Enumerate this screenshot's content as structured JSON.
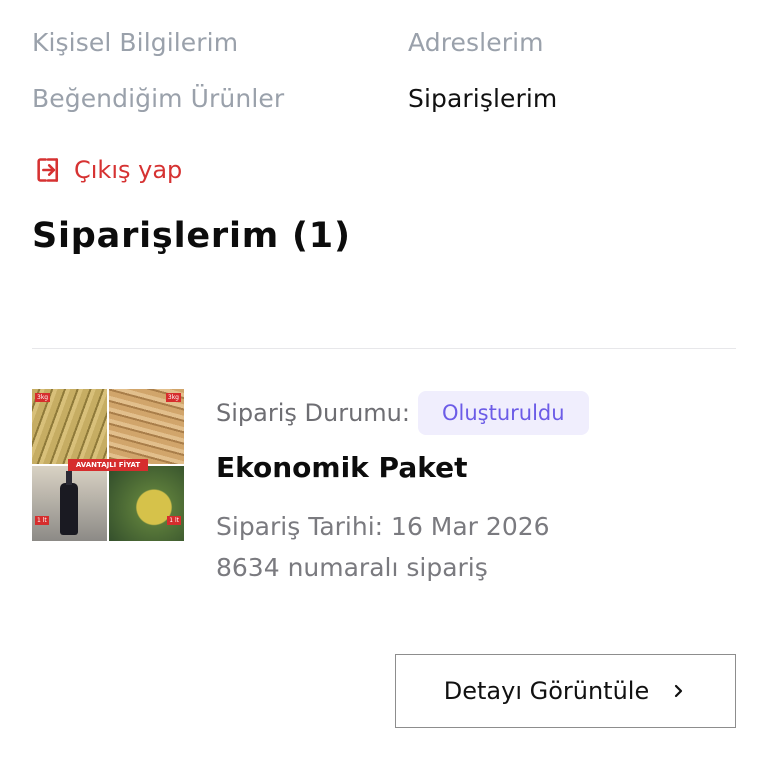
{
  "account_nav": {
    "personal_info": "Kişisel Bilgilerim",
    "addresses": "Adreslerim",
    "liked_products": "Beğendiğim Ürünler",
    "orders": "Siparişlerim",
    "active": "orders"
  },
  "logout": {
    "label": "Çıkış yap",
    "icon": "logout-icon",
    "color": "#d63232"
  },
  "page": {
    "title": "Siparişlerim (1)"
  },
  "order": {
    "status_label": "Sipariş Durumu:",
    "status_value": "Oluşturuldu",
    "product_name": "Ekonomik Paket",
    "date_text": "Sipariş Tarihi: 16 Mar 2026",
    "number_text": "8634 numaralı sipariş",
    "thumbnail": {
      "promo_text": "AVANTAJLI FİYAT",
      "tag_kg": "3kg",
      "tag_lt": "1 lt"
    },
    "detail_button_label": "Detayı Görüntüle",
    "detail_button_icon": "chevron-right-icon"
  },
  "colors": {
    "accent": "#6c5ce7",
    "badge_bg": "#f0eefd",
    "muted_text": "#9aa1ab",
    "danger": "#d63232"
  }
}
